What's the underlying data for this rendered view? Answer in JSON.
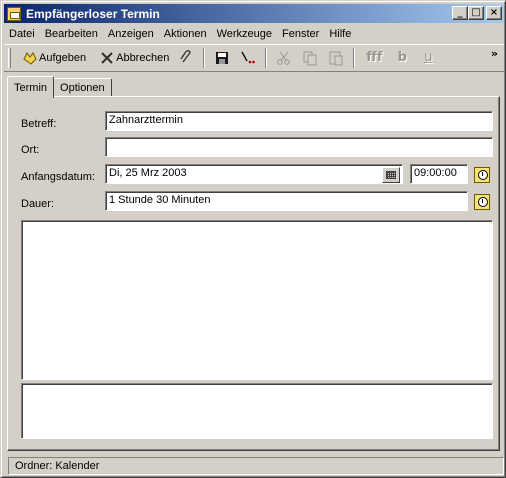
{
  "window": {
    "title": "Empfängerloser Termin",
    "controls": {
      "minimize": "_",
      "maximize": "□",
      "close": "×"
    }
  },
  "menu": [
    "Datei",
    "Bearbeiten",
    "Anzeigen",
    "Aktionen",
    "Werkzeuge",
    "Fenster",
    "Hilfe"
  ],
  "toolbar": {
    "aufgeben_label": "Aufgeben",
    "abbrechen_label": "Abbrechen",
    "icons": [
      "hand-icon",
      "cancel-x-icon",
      "paperclip-icon",
      "save-icon",
      "flag-icon",
      "cut-icon",
      "copy-icon",
      "paste-icon",
      "font-icon",
      "bold-icon",
      "underline-icon"
    ],
    "font_glyph": "fff",
    "bold_glyph": "b",
    "underline_glyph": "u",
    "overflow_glyph": "»"
  },
  "tabs": [
    {
      "label": "Termin",
      "active": true
    },
    {
      "label": "Optionen",
      "active": false
    }
  ],
  "form": {
    "betreff_label": "Betreff:",
    "betreff_value": "Zahnarzttermin",
    "ort_label": "Ort:",
    "ort_value": "",
    "start_label": "Anfangsdatum:",
    "start_date": "Di, 25 Mrz 2003",
    "start_time": "09:00:00",
    "dauer_label": "Dauer:",
    "dauer_value": "1 Stunde 30 Minuten"
  },
  "status": {
    "text": "Ordner: Kalender"
  },
  "colors": {
    "title_start": "#0a246a",
    "title_end": "#a6caf0",
    "face": "#d4d0c8"
  }
}
